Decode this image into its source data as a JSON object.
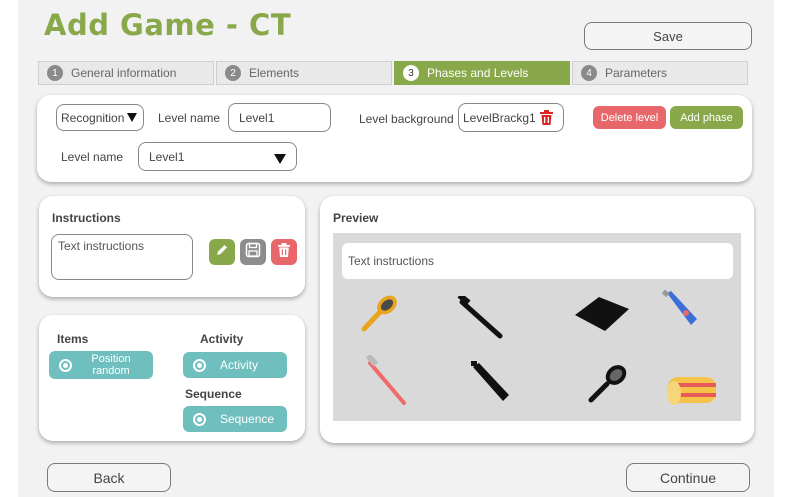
{
  "header": {
    "title": "Add Game - CT",
    "save_label": "Save"
  },
  "steps": [
    {
      "num": "1",
      "label": "General information"
    },
    {
      "num": "2",
      "label": "Elements"
    },
    {
      "num": "3",
      "label": "Phases and Levels"
    },
    {
      "num": "4",
      "label": "Parameters"
    }
  ],
  "level_panel": {
    "type_select": "Recognition",
    "level_name_label": "Level name",
    "level_name_value": "Level1",
    "background_label": "Level background",
    "background_value": "LevelBrackg1",
    "delete_level_label": "Delete level",
    "add_phase_label": "Add phase",
    "level_name_label_2": "Level name",
    "level_select_value": "Level1"
  },
  "instructions": {
    "heading": "Instructions",
    "placeholder": "Text instructions"
  },
  "options": {
    "items_heading": "Items",
    "position_random_label": "Position random",
    "activity_heading": "Activity",
    "activity_label": "Activity",
    "sequence_heading": "Sequence",
    "sequence_label": "Sequence"
  },
  "preview": {
    "heading": "Preview",
    "text": "Text instructions",
    "items": [
      "hairbrush",
      "toothbrush",
      "wallet",
      "toothpaste",
      "toothbrush",
      "toothpaste",
      "hairbrush",
      "towel"
    ]
  },
  "footer": {
    "back_label": "Back",
    "continue_label": "Continue"
  },
  "colors": {
    "accent": "#88a84a",
    "danger": "#e8676b",
    "teal": "#6fbfbf"
  }
}
